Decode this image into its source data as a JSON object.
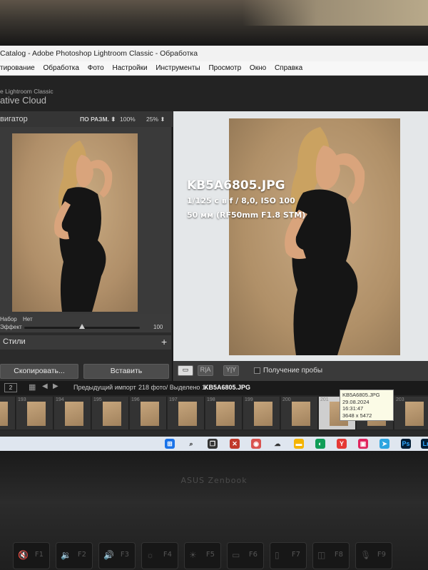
{
  "window": {
    "title": "Catalog - Adobe Photoshop Lightroom Classic - Обработка"
  },
  "menu": [
    "тирование",
    "Обработка",
    "Фото",
    "Настройки",
    "Инструменты",
    "Просмотр",
    "Окно",
    "Справка"
  ],
  "header": {
    "line1": "e Lightroom Classic",
    "line2": "ative Cloud"
  },
  "navigator": {
    "title": "вигатор",
    "zoom_fit": "ПО РАЗМ. ⬍",
    "zoom_100": "100%",
    "zoom_25": "25% ⬍"
  },
  "presets": {
    "set_label": "Набор",
    "set_value": "Нет",
    "effect_label": "Эффект",
    "effect_value": "100",
    "effect_level": 0.5
  },
  "styles": {
    "title": "Стили",
    "add": "+"
  },
  "buttons": {
    "copy": "Скопировать...",
    "paste": "Вставить"
  },
  "photo_info": {
    "filename": "KB5A6805.JPG",
    "exposure": "1/125 с в f / 8,0, ISO 100",
    "lens": "50 мм (RF50mm F1.8 STM)"
  },
  "toolbar": {
    "view_single": "▭",
    "view_ra": "R|A",
    "view_yy": "Y|Y",
    "soft_proof": "Получение пробы"
  },
  "filmstrip_bar": {
    "page": "2",
    "source": "Предыдущий импорт",
    "counts": "218 фото/ Выделено 1/",
    "current": "KB5A6805.JPG"
  },
  "filmstrip": {
    "numbers": [
      "",
      "193",
      "194",
      "195",
      "196",
      "197",
      "198",
      "199",
      "200",
      "201",
      "",
      "203"
    ]
  },
  "tooltip": {
    "name": "KB5A6805.JPG",
    "date": "29.08.2024 16:31:47",
    "size": "3648 x 5472"
  },
  "bezel": {
    "brand": "ASUS Zenbook"
  },
  "keyboard": {
    "keys": [
      "F1",
      "F2",
      "F3",
      "F4",
      "F5",
      "F6",
      "F7",
      "F8",
      "F9"
    ]
  },
  "colors": {
    "backdrop": "#b89a72",
    "dress": "#151515",
    "skin": "#d9a47c",
    "hair": "#caa261"
  }
}
